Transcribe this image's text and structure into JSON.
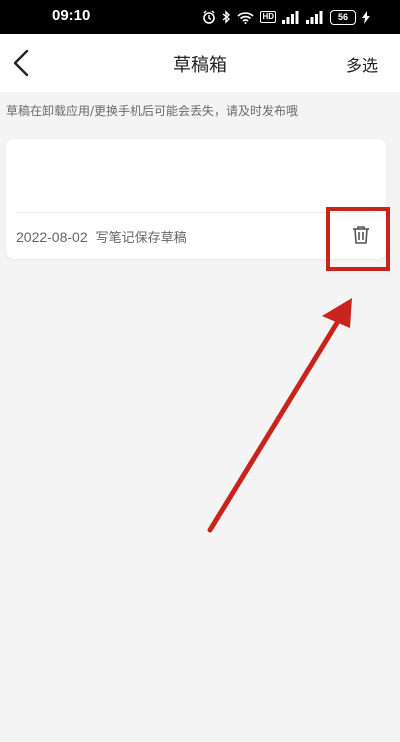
{
  "status_bar": {
    "time": "09:10",
    "hd_label": "HD",
    "battery_level": "56",
    "icons": [
      "alarm-icon",
      "bluetooth-icon",
      "wifi-icon",
      "signal-icon",
      "signal-icon",
      "battery-icon",
      "charging-icon"
    ]
  },
  "navbar": {
    "title": "草稿箱",
    "multi_select_label": "多选",
    "back_icon": "back-arrow-icon"
  },
  "notice": "草稿在卸载应用/更换手机后可能会丢失，请及时发布哦",
  "drafts": [
    {
      "date": "2022-08-02",
      "label": "写笔记保存草稿",
      "action_icon": "trash-icon"
    }
  ],
  "annotation": {
    "color": "#c8241c",
    "shapes": [
      "highlight-box",
      "pointer-arrow"
    ]
  },
  "colors": {
    "background": "#f4f4f4",
    "card": "#ffffff",
    "text_primary": "#222222",
    "text_secondary": "#666666"
  }
}
